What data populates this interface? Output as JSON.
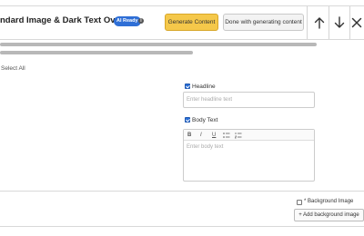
{
  "header": {
    "title": "ndard Image & Dark Text Overlay",
    "badge": "AI Ready",
    "info_icon": "i",
    "generate_label": "Generate Content",
    "done_label": "Done with generating content",
    "icons": [
      "arrow-up-icon",
      "arrow-down-icon",
      "close-icon"
    ]
  },
  "list": {
    "select_all": "Select All"
  },
  "form": {
    "headline_label": "Headline",
    "headline_placeholder": "Enter headline text",
    "body_label": "Body Text",
    "body_placeholder": "Enter body text",
    "toolbar": {
      "bold": "B",
      "italic": "I",
      "underline": "U"
    },
    "background_label": "* Background Image",
    "add_background_label": "+ Add background image"
  },
  "colors": {
    "generate_button": "#f5c84a",
    "badge": "#2f6fd6",
    "checkbox": "#2a6fd8"
  }
}
